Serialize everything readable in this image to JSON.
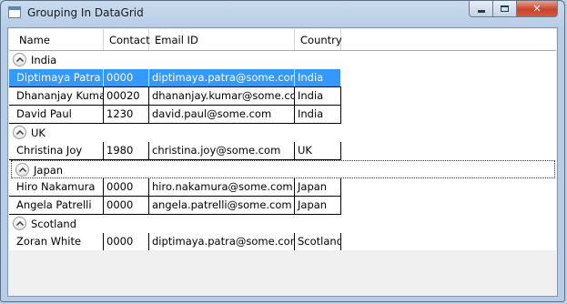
{
  "window": {
    "title": "Grouping In DataGrid"
  },
  "columns": [
    "Name",
    "Contact",
    "Email ID",
    "Country"
  ],
  "groups": [
    {
      "name": "India",
      "rows": [
        [
          "Diptimaya Patra",
          "0000",
          "diptimaya.patra@some.com",
          "India"
        ],
        [
          "Dhananjay Kumar",
          "00020",
          "dhananjay.kumar@some.com",
          "India"
        ],
        [
          "David Paul",
          "1230",
          "david.paul@some.com",
          "India"
        ]
      ]
    },
    {
      "name": "UK",
      "rows": [
        [
          "Christina Joy",
          "1980",
          "christina.joy@some.com",
          "UK"
        ]
      ]
    },
    {
      "name": "Japan",
      "rows": [
        [
          "Hiro Nakamura",
          "0000",
          "hiro.nakamura@some.com",
          "Japan"
        ],
        [
          "Angela Patrelli",
          "0000",
          "angela.patrelli@some.com",
          "Japan"
        ]
      ]
    },
    {
      "name": "Scotland",
      "rows": [
        [
          "Zoran White",
          "0000",
          "diptimaya.patra@some.com",
          "Scotland"
        ]
      ]
    }
  ],
  "selected_row": "Diptimaya Patra",
  "focused_group": "Japan",
  "colors": {
    "selection": "#3399ff",
    "close_button": "#c8432b"
  }
}
